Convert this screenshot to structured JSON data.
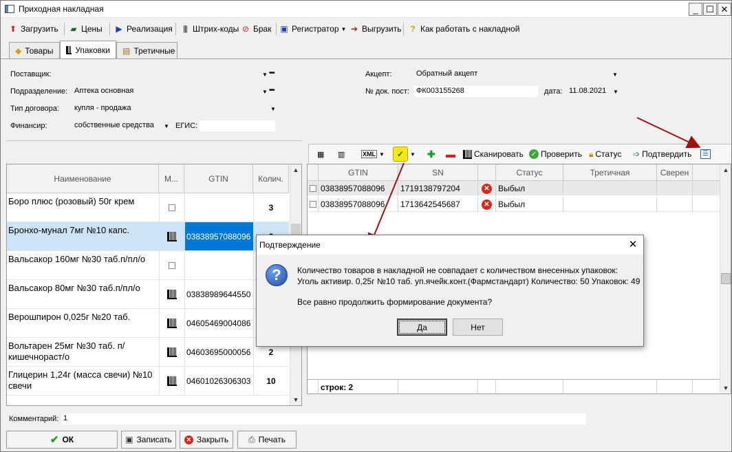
{
  "window": {
    "title": "Приходная накладная"
  },
  "toolbar": [
    {
      "label": "Загрузить",
      "icon": "load-icon"
    },
    {
      "label": "Цены",
      "icon": "price-icon"
    },
    {
      "label": "Реализация",
      "icon": "sales-icon"
    },
    {
      "label": "Штрих-коды",
      "icon": "barcode-icon"
    },
    {
      "label": "Брак",
      "icon": "defect-icon"
    },
    {
      "label": "Регистратор",
      "icon": "registrar-icon"
    },
    {
      "label": "Выгрузить",
      "icon": "upload-icon"
    },
    {
      "label": "Как работать с накладной",
      "icon": "help-icon"
    }
  ],
  "tabs": [
    {
      "label": "Товары",
      "icon": "pill-icon"
    },
    {
      "label": "Упаковки",
      "icon": "datamatrix-icon",
      "active": true
    },
    {
      "label": "Третичные",
      "icon": "box-icon"
    }
  ],
  "form": {
    "supplier_label": "Поставщик:",
    "supplier_value": "",
    "division_label": "Подразделение:",
    "division_value": "Аптека основная",
    "contract_label": "Тип договора:",
    "contract_value": "купля - продажа",
    "finance_label": "Финансир:",
    "finance_value": "собственные средства",
    "egis_label": "ЕГИС:",
    "egis_value": "",
    "accept_label": "Акцепт:",
    "accept_value": "Обратный акцепт",
    "docno_label": "№ док. пост:",
    "docno_value": "ФК003155268",
    "date_label": "дата:",
    "date_value": "11.08.2021"
  },
  "left_table": {
    "columns": [
      "Наименование",
      "М...",
      "GTIN",
      "Колич."
    ],
    "rows": [
      {
        "name": "Боро плюс (розовый) 50г крем",
        "mark": "checkbox",
        "gtin": "",
        "qty": "3"
      },
      {
        "name": "Бронхо-мунал 7мг №10 капс.",
        "mark": "datamatrix",
        "gtin": "03838957088096",
        "qty": "2",
        "selected": true
      },
      {
        "name": "Вальсакор 160мг №30 таб.п/пл/о",
        "mark": "checkbox",
        "gtin": "",
        "qty": ""
      },
      {
        "name": "Вальсакор 80мг №30 таб.п/пл/о",
        "mark": "datamatrix",
        "gtin": "03838989644550",
        "qty": ""
      },
      {
        "name": "Верошпирон 0,025г №20 таб.",
        "mark": "datamatrix",
        "gtin": "04605469004086",
        "qty": ""
      },
      {
        "name": "Вольтарен 25мг №30 таб. п/кишечнораст/о",
        "mark": "datamatrix",
        "gtin": "04603695000056",
        "qty": "2"
      },
      {
        "name": "Глицерин 1,24г (масса свечи) №10 свечи",
        "mark": "datamatrix",
        "gtin": "04601026306303",
        "qty": "10"
      }
    ]
  },
  "right_toolbar": {
    "xml": "XML",
    "scan": "Сканировать",
    "check": "Проверить",
    "status": "Статус",
    "confirm": "Подтвердить"
  },
  "right_table": {
    "columns": [
      "GTIN",
      "SN",
      "",
      "Статус",
      "Третичная",
      "Сверен"
    ],
    "rows": [
      {
        "gtin": "03838957088096",
        "sn": "1719138797204",
        "status": "Выбыл"
      },
      {
        "gtin": "03838957088096",
        "sn": "1713642545687",
        "status": "Выбыл"
      }
    ],
    "footer": "строк: 2"
  },
  "dialog": {
    "title": "Подтверждение",
    "line1": "Количество товаров в накладной не совпадает с количеством внесенных упаковок:",
    "line2": "Уголь активир. 0,25г №10 таб. уп.ячейк.конт.(Фармстандарт) Количество: 50 Упаковок: 49",
    "line3": "Все равно продолжить формирование документа?",
    "yes": "Да",
    "no": "Нет"
  },
  "comment": {
    "label": "Комментарий:",
    "value": "1"
  },
  "buttons": {
    "ok": "ОК",
    "save": "Записать",
    "close": "Закрыть",
    "print": "Печать"
  },
  "colors": {
    "selection": "#cce4f7",
    "selected_cell": "#0078d7",
    "status_error": "#d9261c",
    "arrow": "#a01010",
    "highlight_icon": "#f5e614"
  }
}
